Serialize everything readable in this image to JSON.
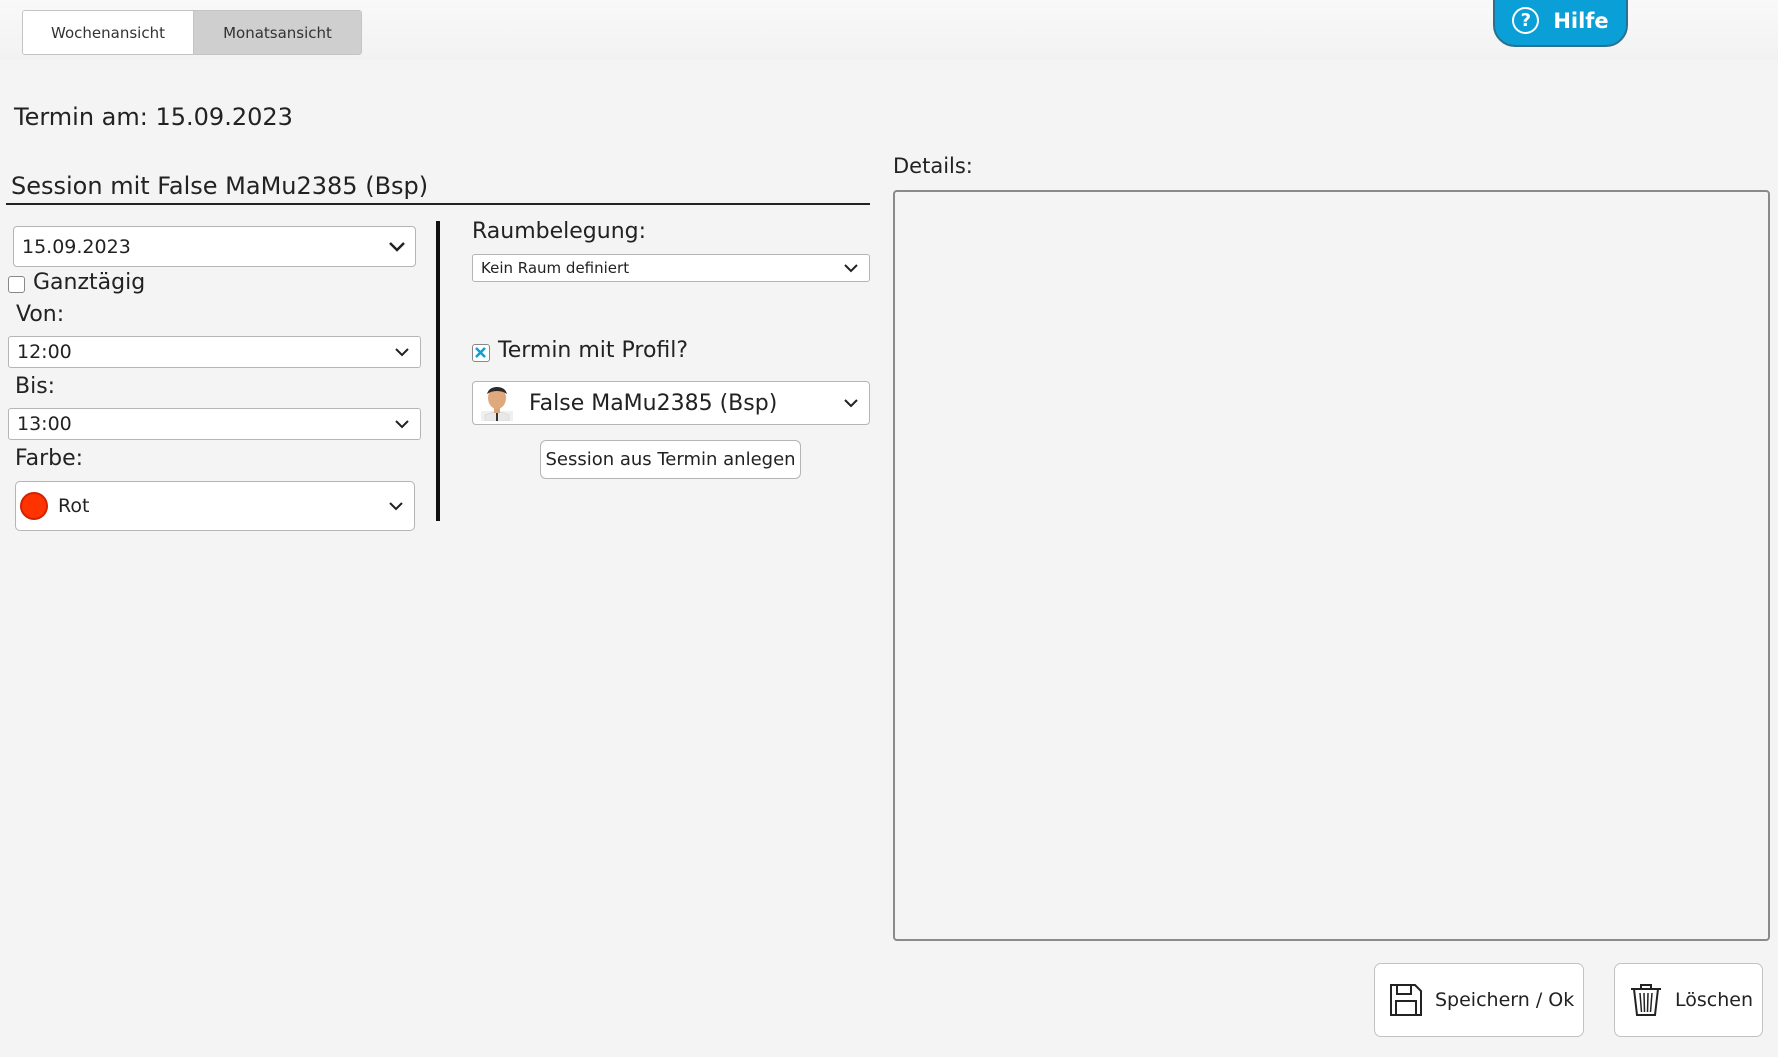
{
  "toolbar": {
    "tab_week": "Wochenansicht",
    "tab_month": "Monatsansicht",
    "help_label": "Hilfe"
  },
  "appointment": {
    "date_heading": "Termin am: 15.09.2023",
    "session_title": "Session mit False MaMu2385 (Bsp)"
  },
  "form": {
    "date_value": "15.09.2023",
    "allday_label": "Ganztägig",
    "allday_checked": false,
    "from_label": "Von:",
    "from_value": "12:00",
    "to_label": "Bis:",
    "to_value": "13:00",
    "color_label": "Farbe:",
    "color_value": "Rot",
    "color_hex": "#ff3300",
    "room_label": "Raumbelegung:",
    "room_value": "Kein Raum definiert",
    "profile_check_label": "Termin mit Profil?",
    "profile_checked": true,
    "profile_value": "False MaMu2385 (Bsp)",
    "create_session_button": "Session aus Termin anlegen"
  },
  "details": {
    "label": "Details:",
    "text": ""
  },
  "actions": {
    "save_label": "Speichern / Ok",
    "delete_label": "Löschen"
  },
  "colors": {
    "accent": "#0a9fd7",
    "checkbox_mark": "#0a9fd7"
  }
}
